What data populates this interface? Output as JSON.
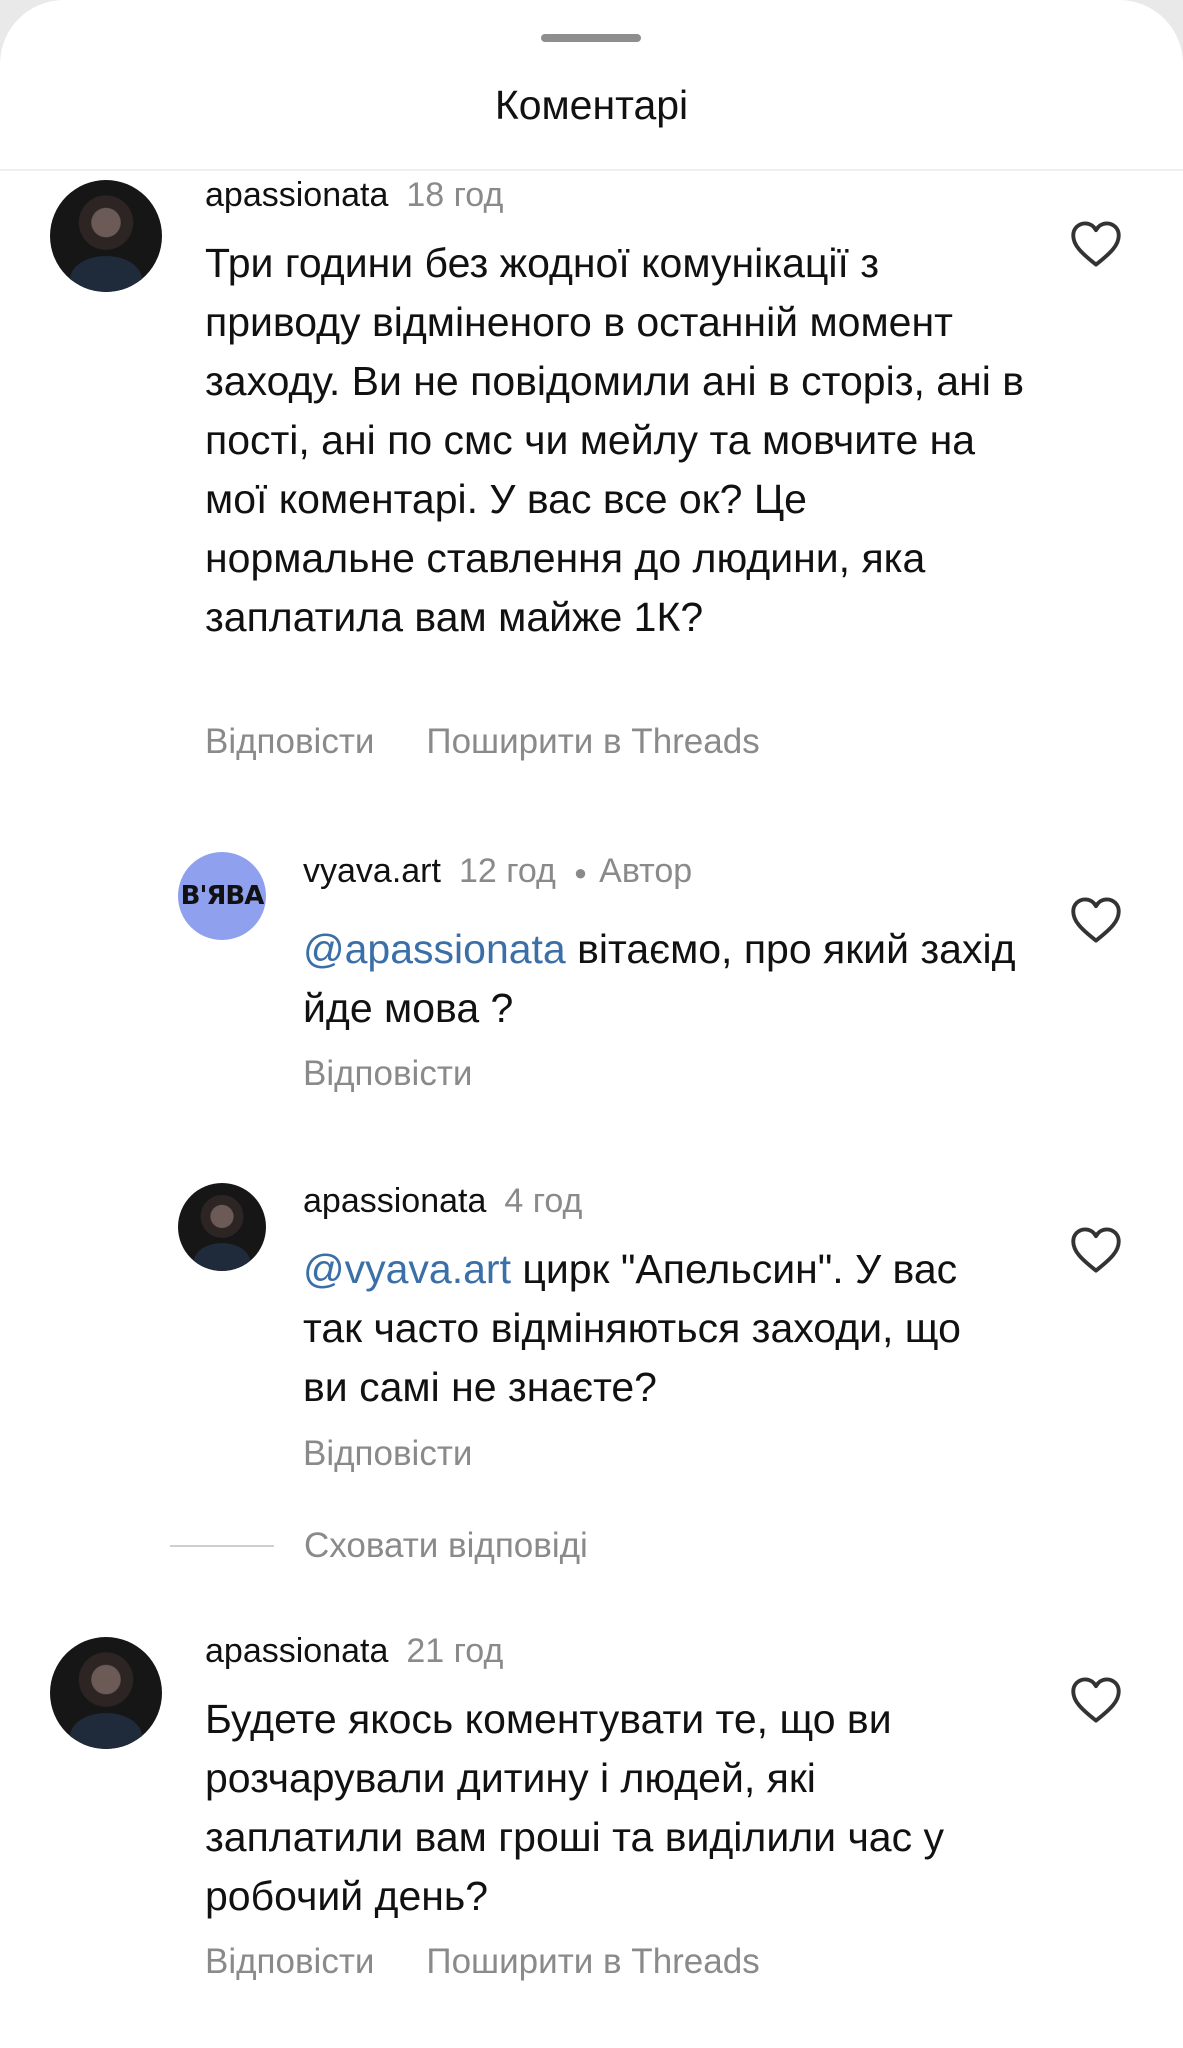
{
  "header": {
    "title": "Коментарі"
  },
  "comments": [
    {
      "username": "apassionata",
      "time": "18 год",
      "text": "Три години без жодної комунікації з приводу відміненого в останній момент заходу. Ви не повідомили ані в сторіз, ані в пості, ані по смс чи мейлу та мовчите на мої коментарі. У вас все ок? Це нормальне ставлення до людини, яка заплатила вам майже 1К?",
      "reply_label": "Відповісти",
      "share_label": "Поширити в Threads"
    },
    {
      "username": "vyava.art",
      "time": "12 год",
      "author_badge": "Автор",
      "mention": "@apassionata",
      "text": " вітаємо, про який захід йде мова ?",
      "reply_label": "Відповісти"
    },
    {
      "username": "apassionata",
      "time": "4 год",
      "mention": "@vyava.art",
      "text": " цирк \"Апельсин\". У вас так часто відміняються заходи, що ви самі не знаєте?",
      "reply_label": "Відповісти"
    },
    {
      "username": "apassionata",
      "time": "21 год",
      "text": "Будете якось коментувати те, що ви розчарували дитину і людей, які заплатили вам гроші та виділили час у робочий день?",
      "reply_label": "Відповісти",
      "share_label": "Поширити в Threads"
    }
  ],
  "hide_replies_label": "Сховати відповіді",
  "icons": {
    "like": "heart-outline-icon"
  },
  "colors": {
    "mention": "#3b6fa8",
    "secondary_text": "#8a8a8a",
    "brand_avatar": "#8fa0ee"
  }
}
